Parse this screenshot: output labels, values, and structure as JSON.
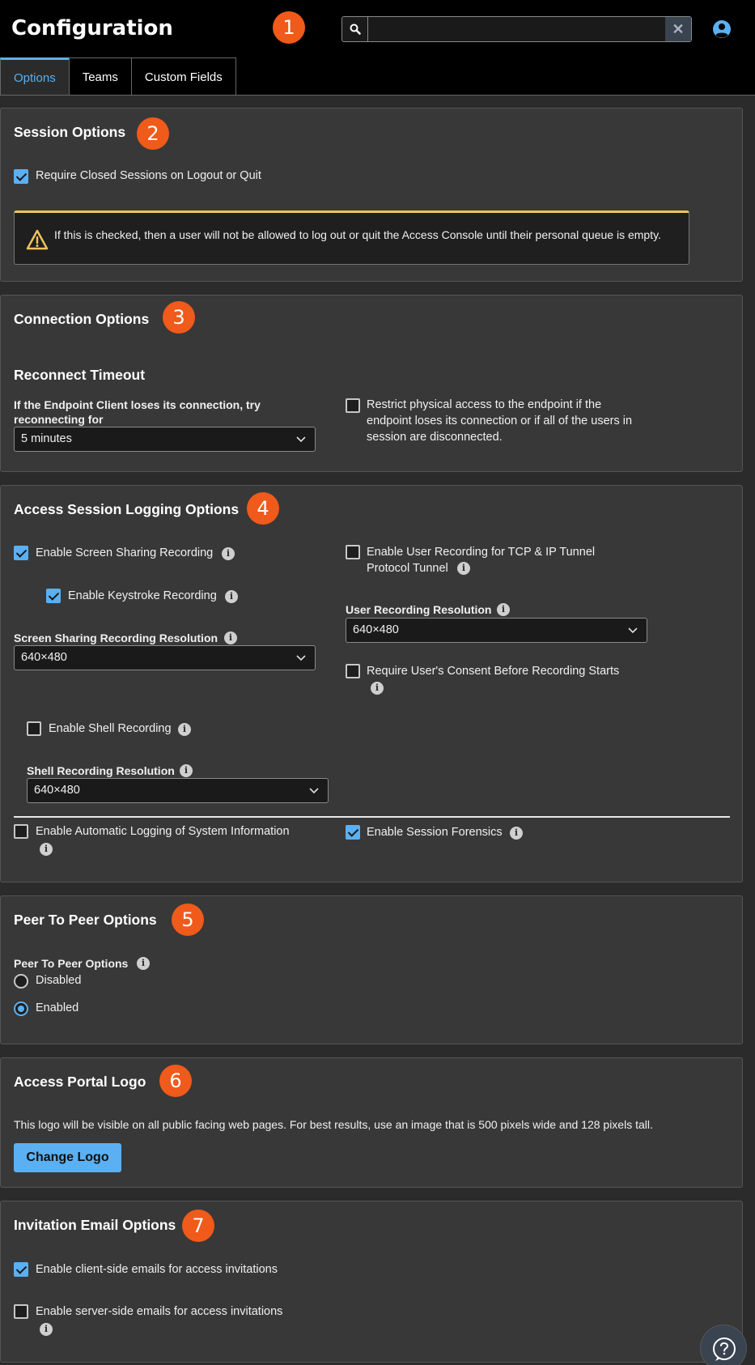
{
  "header": {
    "title": "Configuration",
    "search": {
      "value": "",
      "placeholder": "",
      "clear_label": "✕"
    }
  },
  "tabs": [
    {
      "label": "Options",
      "active": true
    },
    {
      "label": "Teams",
      "active": false
    },
    {
      "label": "Custom Fields",
      "active": false
    }
  ],
  "badges": [
    "1",
    "2",
    "3",
    "4",
    "5",
    "6",
    "7"
  ],
  "session_options": {
    "title": "Session Options",
    "require_closed_label": "Require Closed Sessions on Logout or Quit",
    "require_closed_checked": true,
    "warning": "If this is checked, then a user will not be allowed to log out or quit the Access Console until their personal queue is empty."
  },
  "connection_options": {
    "title": "Connection Options",
    "subtitle": "Reconnect Timeout",
    "reconnect_label": "If the Endpoint Client loses its connection, try reconnecting for",
    "reconnect_value": "5 minutes",
    "restrict_label": "Restrict physical access to the endpoint if the endpoint loses its connection or if all of the users in session are disconnected.",
    "restrict_checked": false
  },
  "logging_options": {
    "title": "Access Session Logging Options",
    "screen_sharing_label": "Enable Screen Sharing Recording",
    "screen_sharing_checked": true,
    "keystroke_label": "Enable Keystroke Recording",
    "keystroke_checked": true,
    "screen_res_label": "Screen Sharing Recording Resolution",
    "screen_res_value": "640×480",
    "user_rec_label": "Enable User Recording for TCP & IP Tunnel Protocol Tunnel",
    "user_rec_checked": false,
    "user_res_label": "User Recording Resolution",
    "user_res_value": "640×480",
    "consent_label": "Require User's Consent Before Recording Starts",
    "consent_checked": false,
    "shell_label": "Enable Shell Recording",
    "shell_checked": false,
    "shell_res_label": "Shell Recording Resolution",
    "shell_res_value": "640×480",
    "auto_log_label": "Enable Automatic Logging of System Information",
    "auto_log_checked": false,
    "forensics_label": "Enable Session Forensics",
    "forensics_checked": true
  },
  "peer_options": {
    "title": "Peer To Peer Options",
    "field_label": "Peer To Peer Options",
    "options": [
      {
        "label": "Disabled",
        "checked": false
      },
      {
        "label": "Enabled",
        "checked": true
      }
    ]
  },
  "portal_logo": {
    "title": "Access Portal Logo",
    "description": "This logo will be visible on all public facing web pages. For best results, use an image that is 500 pixels wide and 128 pixels tall.",
    "button_label": "Change Logo"
  },
  "invitation_options": {
    "title": "Invitation Email Options",
    "client_label": "Enable client-side emails for access invitations",
    "client_checked": true,
    "server_label": "Enable server-side emails for access invitations",
    "server_checked": false
  },
  "colors": {
    "accent": "#5ab0f2",
    "badge": "#f05a1a",
    "warning": "#f0c060"
  }
}
